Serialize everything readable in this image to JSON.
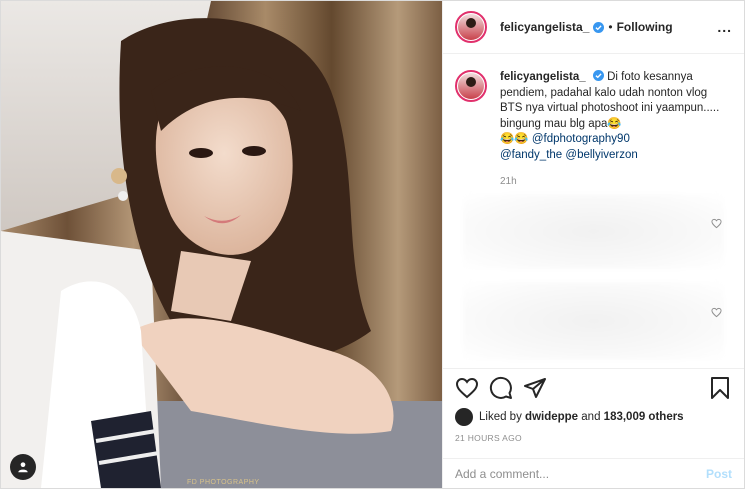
{
  "header": {
    "username": "felicyangelista_",
    "separator": "•",
    "follow_status": "Following",
    "more_label": "..."
  },
  "caption": {
    "username": "felicyangelista_",
    "text_1": "Di foto kesannya pendiem, padahal kalo udah nonton vlog BTS nya virtual photoshoot ini yaampun..... bingung mau blg apa",
    "emoji_1": "😂",
    "emoji_2": "😂😂",
    "mention_1": "@fdphotography90",
    "mention_2": "@fandy_the",
    "mention_3": "@bellyiverzon",
    "time": "21h"
  },
  "likes": {
    "prefix": "Liked by",
    "liker": "dwideppe",
    "mid": "and",
    "count": "183,009 others"
  },
  "posted_ago": "21 HOURS AGO",
  "comment_box": {
    "placeholder": "Add a comment...",
    "post_label": "Post"
  },
  "media": {
    "watermark": "FD PHOTOGRAPHY"
  },
  "colors": {
    "verified": "#3897f0",
    "post_disabled": "#b2dffc",
    "mention": "#00376b"
  },
  "icons": [
    "heart-icon",
    "comment-icon",
    "share-icon",
    "bookmark-icon",
    "verified-badge-icon",
    "user-tag-icon"
  ]
}
